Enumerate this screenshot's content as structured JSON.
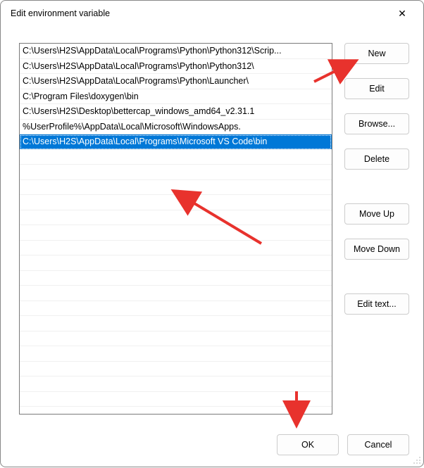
{
  "window": {
    "title": "Edit environment variable",
    "close_label": "✕"
  },
  "list": {
    "items": [
      "C:\\Users\\H2S\\AppData\\Local\\Programs\\Python\\Python312\\Scrip...",
      "C:\\Users\\H2S\\AppData\\Local\\Programs\\Python\\Python312\\",
      "C:\\Users\\H2S\\AppData\\Local\\Programs\\Python\\Launcher\\",
      "C:\\Program Files\\doxygen\\bin",
      "C:\\Users\\H2S\\Desktop\\bettercap_windows_amd64_v2.31.1",
      "%UserProfile%\\AppData\\Local\\Microsoft\\WindowsApps.",
      "C:\\Users\\H2S\\AppData\\Local\\Programs\\Microsoft VS Code\\bin"
    ],
    "selected_index": 6
  },
  "buttons": {
    "new": "New",
    "edit": "Edit",
    "browse": "Browse...",
    "delete": "Delete",
    "move_up": "Move Up",
    "move_down": "Move Down",
    "edit_text": "Edit text...",
    "ok": "OK",
    "cancel": "Cancel"
  }
}
